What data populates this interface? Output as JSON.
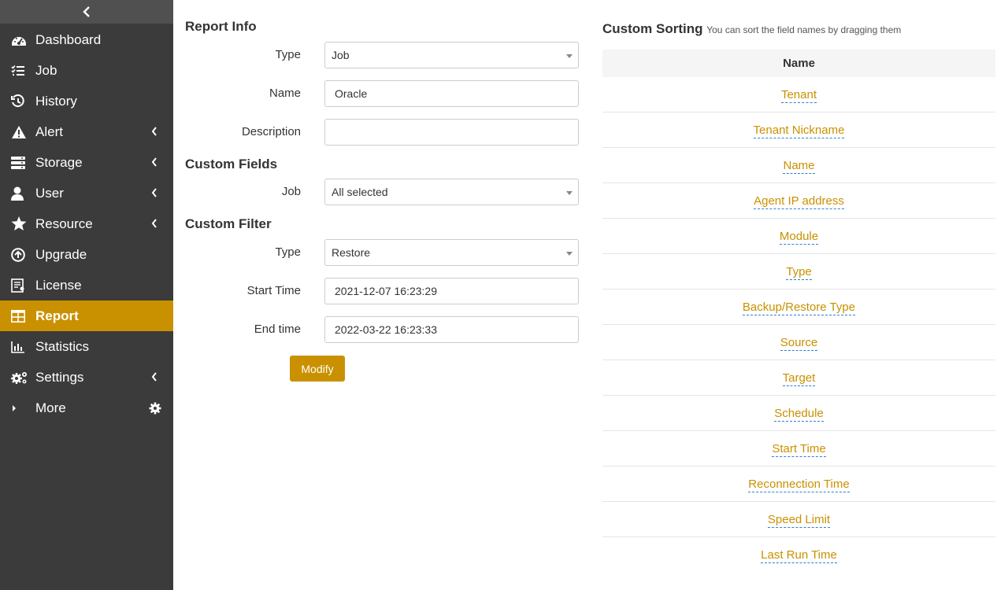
{
  "sidebar": {
    "items": [
      {
        "label": "Dashboard",
        "icon": "dashboard-icon"
      },
      {
        "label": "Job",
        "icon": "job-list-icon"
      },
      {
        "label": "History",
        "icon": "history-icon"
      },
      {
        "label": "Alert",
        "icon": "alert-icon"
      },
      {
        "label": "Storage",
        "icon": "storage-icon"
      },
      {
        "label": "User",
        "icon": "user-icon"
      },
      {
        "label": "Resource",
        "icon": "star-icon"
      },
      {
        "label": "Upgrade",
        "icon": "upgrade-icon"
      },
      {
        "label": "License",
        "icon": "license-icon"
      },
      {
        "label": "Report",
        "icon": "table-icon",
        "active": true
      },
      {
        "label": "Statistics",
        "icon": "bar-chart-icon"
      },
      {
        "label": "Settings",
        "icon": "cogs-icon"
      },
      {
        "label": "More",
        "icon": "caret-right-icon"
      }
    ]
  },
  "report_info": {
    "title": "Report Info",
    "type_label": "Type",
    "type_value": "Job",
    "name_label": "Name",
    "name_value": "Oracle",
    "description_label": "Description",
    "description_value": ""
  },
  "custom_fields": {
    "title": "Custom Fields",
    "job_label": "Job",
    "job_value": "All selected"
  },
  "custom_filter": {
    "title": "Custom Filter",
    "type_label": "Type",
    "type_value": "Restore",
    "start_label": "Start Time",
    "start_value": "2021-12-07 16:23:29",
    "end_label": "End time",
    "end_value": "2022-03-22 16:23:33"
  },
  "modify_button": "Modify",
  "custom_sorting": {
    "title": "Custom Sorting",
    "hint": "You can sort the field names by dragging them",
    "header": "Name",
    "rows": [
      "Tenant",
      "Tenant Nickname",
      "Name",
      "Agent IP address",
      "Module",
      "Type",
      "Backup/Restore Type",
      "Source",
      "Target",
      "Schedule",
      "Start Time",
      "Reconnection Time",
      "Speed Limit",
      "Last Run Time"
    ]
  },
  "colors": {
    "accent": "#c99100",
    "sidebar_bg": "#3b3b3b",
    "link_underline": "#2f7fd3"
  }
}
